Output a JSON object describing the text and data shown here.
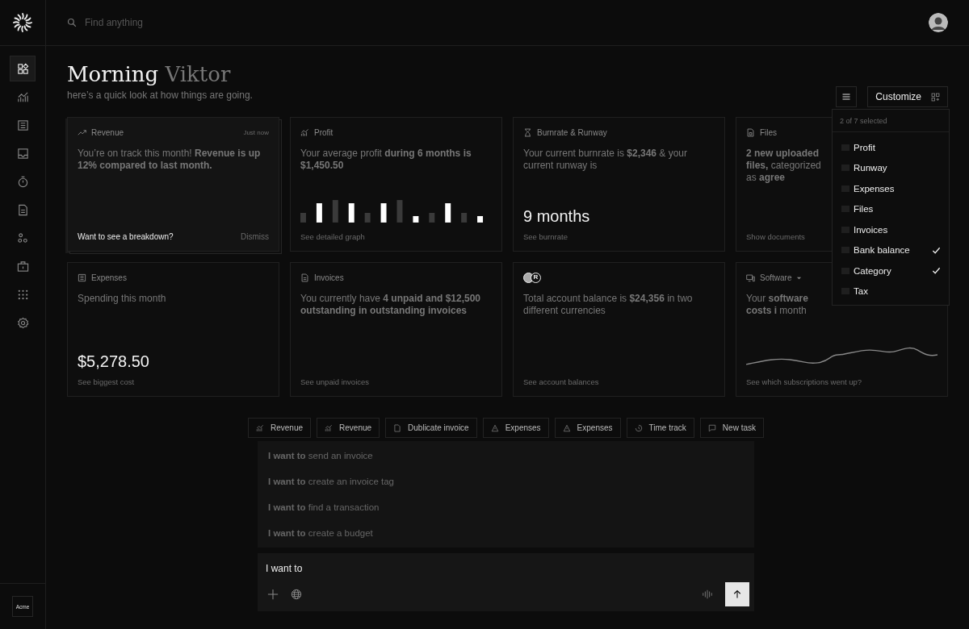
{
  "search": {
    "placeholder": "Find anything"
  },
  "sidebar": {
    "items": [
      {
        "selected": true
      },
      {
        "selected": false
      },
      {
        "selected": false
      },
      {
        "selected": false
      },
      {
        "selected": false
      },
      {
        "selected": false
      },
      {
        "selected": false
      },
      {
        "selected": false
      },
      {
        "selected": false
      },
      {
        "selected": false
      }
    ],
    "team": "Acme"
  },
  "header": {
    "greeting": "Morning",
    "name": "Viktor",
    "subtitle": "here’s a quick look at how things are going.",
    "customize": "Customize"
  },
  "cards": [
    {
      "kind": "revenue",
      "title": "Revenue",
      "timestamp": "Just now",
      "text": "You’re on track this month! **Revenue is up 12% compared to last month.**",
      "prompt": "Want to see a breakdown?",
      "action": "Dismiss"
    },
    {
      "kind": "bars",
      "title": "Profit",
      "text": "Your average profit **during 6 months is $1,450.50**",
      "footer": "See detailed graph"
    },
    {
      "kind": "value",
      "title": "Burnrate & Runway",
      "text": "Your current burnrate is **$2,346** & your current runway is",
      "value": "9 months",
      "footer": "See burnrate"
    },
    {
      "kind": "text",
      "title": "Files",
      "text": "**2 new uploaded files,** categorized as **agree**",
      "footer": "Show documents"
    },
    {
      "kind": "value",
      "title": "Expenses",
      "text": "Spending this month",
      "value": "$5,278.50",
      "footer": "See biggest cost"
    },
    {
      "kind": "text",
      "title": "Invoices",
      "text": "You currently have **4 unpaid and $12,500 outstanding in outstanding invoices**",
      "footer": "See unpaid invoices"
    },
    {
      "kind": "currency",
      "badge": "R",
      "text": "Total account balance is **$24,356** in two different currencies",
      "footer": "See account balances"
    },
    {
      "kind": "sparkline",
      "title": "Software",
      "text": "Your **software costs i** month",
      "footer": "See which subscriptions went up?"
    }
  ],
  "dropdown": {
    "caption": "2 of 7 selected",
    "items": [
      {
        "label": "Profit",
        "checked": false
      },
      {
        "label": "Runway",
        "checked": false
      },
      {
        "label": "Expenses",
        "checked": false
      },
      {
        "label": "Files",
        "checked": false
      },
      {
        "label": "Invoices",
        "checked": false
      },
      {
        "label": "Bank balance",
        "checked": true
      },
      {
        "label": "Category",
        "checked": true
      },
      {
        "label": "Tax",
        "checked": false
      }
    ]
  },
  "shortcuts": [
    "Revenue",
    "Revenue",
    "Dublicate invoice",
    "Expenses",
    "Expenses",
    "Time track",
    "New task"
  ],
  "suggestions": [
    "**I want to** send an invoice",
    "**I want to** create an invoice tag",
    "**I want to** find a transaction",
    "**I want to** create a budget"
  ],
  "assistant": {
    "value": "I want to"
  }
}
